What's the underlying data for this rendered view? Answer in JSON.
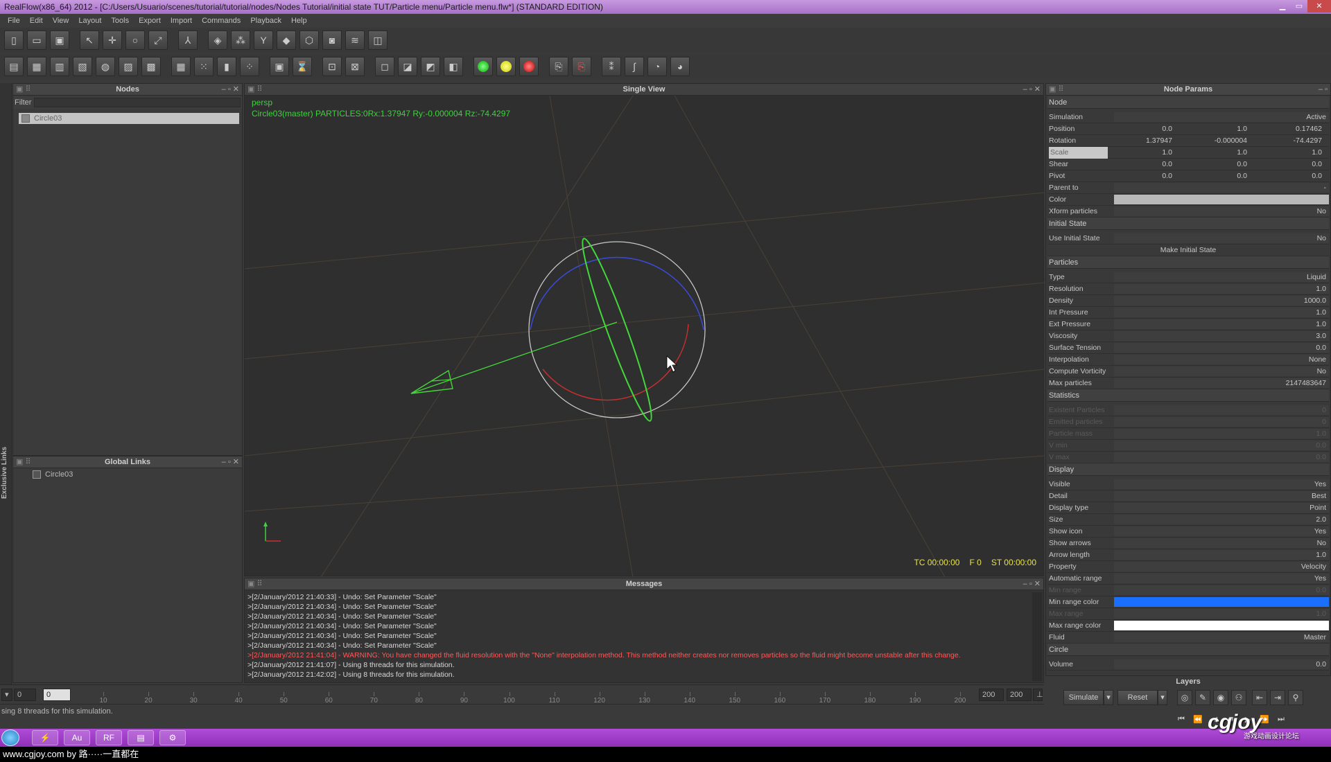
{
  "window": {
    "title": "RealFlow(x86_64) 2012 - [C:/Users/Usuario/scenes/tutorial/tutorial/nodes/Nodes Tutorial/initial state TUT/Particle menu/Particle menu.flw*] (STANDARD EDITION)"
  },
  "menu": [
    "File",
    "Edit",
    "View",
    "Layout",
    "Tools",
    "Export",
    "Import",
    "Commands",
    "Playback",
    "Help"
  ],
  "sidetab": {
    "label": "Exclusive Links"
  },
  "nodes": {
    "title": "Nodes",
    "filter_label": "Filter",
    "filter_value": "",
    "item": "Circle03"
  },
  "global_links": {
    "title": "Global Links",
    "item": "Circle03"
  },
  "viewport": {
    "title": "Single View",
    "camera": "persp",
    "info": "Circle03(master) PARTICLES:0Rx:1.37947 Ry:-0.000004 Rz:-74.4297",
    "tc": "TC 00:00:00",
    "frame": "F 0",
    "st": "ST 00:00:00"
  },
  "messages": {
    "title": "Messages",
    "lines": [
      {
        "text": ">[2/January/2012 21:40:33] - Undo: Set Parameter \"Scale\"",
        "warn": false
      },
      {
        "text": ">[2/January/2012 21:40:34] - Undo: Set Parameter \"Scale\"",
        "warn": false
      },
      {
        "text": ">[2/January/2012 21:40:34] - Undo: Set Parameter \"Scale\"",
        "warn": false
      },
      {
        "text": ">[2/January/2012 21:40:34] - Undo: Set Parameter \"Scale\"",
        "warn": false
      },
      {
        "text": ">[2/January/2012 21:40:34] - Undo: Set Parameter \"Scale\"",
        "warn": false
      },
      {
        "text": ">[2/January/2012 21:40:34] - Undo: Set Parameter \"Scale\"",
        "warn": false
      },
      {
        "text": ">[2/January/2012 21:41:04] - WARNING: You have changed the fluid resolution  with the \"None\" interpolation method. This method  neither creates nor removes particles so the  fluid might become unstable after this change.",
        "warn": true
      },
      {
        "text": ">[2/January/2012 21:41:07] - Using 8 threads for this simulation.",
        "warn": false
      },
      {
        "text": ">[2/January/2012 21:42:02] - Using 8 threads for this simulation.",
        "warn": false
      }
    ]
  },
  "params": {
    "title": "Node Params",
    "rows": [
      {
        "kind": "sec",
        "label": "Node"
      },
      {
        "kind": "val",
        "label": "Simulation",
        "value": "Active"
      },
      {
        "kind": "vec",
        "label": "Position",
        "values": [
          "0.0",
          "1.0",
          "0.17462"
        ]
      },
      {
        "kind": "vec",
        "label": "Rotation",
        "values": [
          "1.37947",
          "-0.000004",
          "-74.4297"
        ]
      },
      {
        "kind": "vec",
        "label": "Scale",
        "values": [
          "1.0",
          "1.0",
          "1.0"
        ],
        "hl": true
      },
      {
        "kind": "vec",
        "label": "Shear",
        "values": [
          "0.0",
          "0.0",
          "0.0"
        ]
      },
      {
        "kind": "vec",
        "label": "Pivot",
        "values": [
          "0.0",
          "0.0",
          "0.0"
        ]
      },
      {
        "kind": "val",
        "label": "Parent to",
        "value": "-"
      },
      {
        "kind": "color",
        "label": "Color",
        "color": "#b8b8b8"
      },
      {
        "kind": "val",
        "label": "Xform particles",
        "value": "No"
      },
      {
        "kind": "sec",
        "label": "Initial State"
      },
      {
        "kind": "val",
        "label": "Use Initial State",
        "value": "No"
      },
      {
        "kind": "btn",
        "label": "Make Initial State"
      },
      {
        "kind": "sec",
        "label": "Particles"
      },
      {
        "kind": "val",
        "label": "Type",
        "value": "Liquid"
      },
      {
        "kind": "val",
        "label": "Resolution",
        "value": "1.0"
      },
      {
        "kind": "val",
        "label": "Density",
        "value": "1000.0"
      },
      {
        "kind": "val",
        "label": "Int Pressure",
        "value": "1.0"
      },
      {
        "kind": "val",
        "label": "Ext Pressure",
        "value": "1.0"
      },
      {
        "kind": "val",
        "label": "Viscosity",
        "value": "3.0"
      },
      {
        "kind": "val",
        "label": "Surface Tension",
        "value": "0.0"
      },
      {
        "kind": "val",
        "label": "Interpolation",
        "value": "None"
      },
      {
        "kind": "val",
        "label": "Compute Vorticity",
        "value": "No"
      },
      {
        "kind": "val",
        "label": "Max particles",
        "value": "2147483647"
      },
      {
        "kind": "sec",
        "label": "Statistics"
      },
      {
        "kind": "val",
        "label": "Existent Particles",
        "value": "0",
        "dim": true
      },
      {
        "kind": "val",
        "label": "Emitted particles",
        "value": "0",
        "dim": true
      },
      {
        "kind": "val",
        "label": "Particle mass",
        "value": "1.0",
        "dim": true
      },
      {
        "kind": "val",
        "label": "V min",
        "value": "0.0",
        "dim": true
      },
      {
        "kind": "val",
        "label": "V max",
        "value": "0.0",
        "dim": true
      },
      {
        "kind": "sec",
        "label": "Display"
      },
      {
        "kind": "val",
        "label": "Visible",
        "value": "Yes"
      },
      {
        "kind": "val",
        "label": "Detail",
        "value": "Best"
      },
      {
        "kind": "val",
        "label": "Display type",
        "value": "Point"
      },
      {
        "kind": "val",
        "label": "Size",
        "value": "2.0"
      },
      {
        "kind": "val",
        "label": "Show icon",
        "value": "Yes"
      },
      {
        "kind": "val",
        "label": "Show arrows",
        "value": "No"
      },
      {
        "kind": "val",
        "label": "Arrow length",
        "value": "1.0"
      },
      {
        "kind": "val",
        "label": "Property",
        "value": "Velocity"
      },
      {
        "kind": "val",
        "label": "Automatic range",
        "value": "Yes"
      },
      {
        "kind": "val",
        "label": "Min range",
        "value": "0.0",
        "dim": true
      },
      {
        "kind": "color",
        "label": "Min range color",
        "color": "#1a6fff"
      },
      {
        "kind": "val",
        "label": "Max range",
        "value": "1.0",
        "dim": true
      },
      {
        "kind": "color",
        "label": "Max range color",
        "color": "#ffffff"
      },
      {
        "kind": "val",
        "label": "Fluid",
        "value": "Master"
      },
      {
        "kind": "sec",
        "label": "Circle"
      },
      {
        "kind": "val",
        "label": "Volume",
        "value": "0.0"
      }
    ]
  },
  "timeline": {
    "start": "0",
    "current": "0",
    "ticks": [
      "10",
      "20",
      "30",
      "40",
      "50",
      "60",
      "70",
      "80",
      "90",
      "100",
      "110",
      "120",
      "130",
      "140",
      "150",
      "160",
      "170",
      "180",
      "190",
      "200"
    ],
    "end_a": "200",
    "end_b": "200"
  },
  "controls": {
    "layers": "Layers",
    "simulate": "Simulate",
    "reset": "Reset"
  },
  "status": {
    "text": "sing 8 threads for this simulation."
  },
  "watermark": {
    "text": "www.cgjoy.com by 路·····一直都在",
    "logo": "cgjoy",
    "logo_sub": "游戏动画设计论坛"
  }
}
